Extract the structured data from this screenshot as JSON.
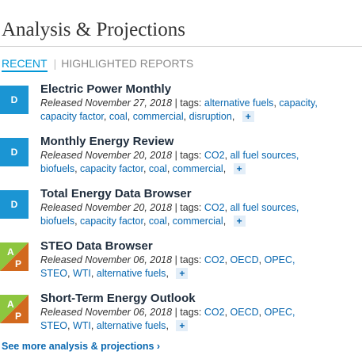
{
  "header": {
    "title": "Analysis & Projections"
  },
  "tabs": {
    "recent": "RECENT",
    "separator": "|",
    "highlighted": "HIGHLIGHTED REPORTS"
  },
  "items": [
    {
      "badge": "D",
      "title": "Electric Power Monthly",
      "released": "Released November 27, 2018",
      "tags_label": "| tags:",
      "line1_tags": [
        "alternative fuels",
        "capacity,"
      ],
      "line2_tags": [
        "capacity factor",
        "coal",
        "commercial",
        "disruption"
      ]
    },
    {
      "badge": "D",
      "title": "Monthly Energy Review",
      "released": "Released November 20, 2018",
      "tags_label": "| tags:",
      "line1_tags": [
        "CO2",
        "all fuel sources,"
      ],
      "line2_tags": [
        "biofuels",
        "capacity factor",
        "coal",
        "commercial"
      ]
    },
    {
      "badge": "D",
      "title": "Total Energy Data Browser",
      "released": "Released November 20, 2018",
      "tags_label": "| tags:",
      "line1_tags": [
        "CO2",
        "all fuel sources,"
      ],
      "line2_tags": [
        "biofuels",
        "capacity factor",
        "coal",
        "commercial"
      ]
    },
    {
      "badge": "AP",
      "badge_a": "A",
      "badge_p": "P",
      "title": "STEO Data Browser",
      "released": "Released November 06, 2018",
      "tags_label": "| tags:",
      "line1_tags": [
        "CO2",
        "OECD",
        "OPEC,"
      ],
      "line2_tags": [
        "STEO",
        "WTI",
        "alternative fuels"
      ]
    },
    {
      "badge": "AP",
      "badge_a": "A",
      "badge_p": "P",
      "title": "Short-Term Energy Outlook",
      "released": "Released November 06, 2018",
      "tags_label": "| tags:",
      "line1_tags": [
        "CO2",
        "OECD",
        "OPEC,"
      ],
      "line2_tags": [
        "STEO",
        "WTI",
        "alternative fuels"
      ]
    }
  ],
  "plus_label": "+",
  "see_more": "See more analysis & projections ›",
  "colors": {
    "d_badge": "#1b95d3",
    "a_badge": "#8dc63f",
    "p_badge": "#d2691e",
    "link": "#0a68b0",
    "accent": "#0096d6"
  }
}
